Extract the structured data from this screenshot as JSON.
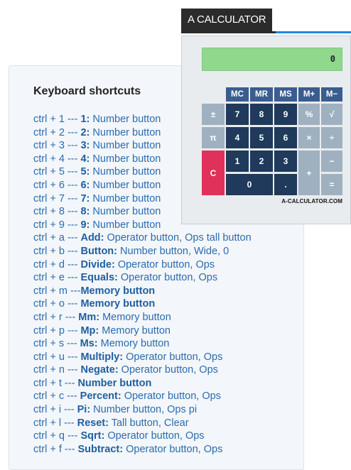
{
  "panel": {
    "title": "Keyboard shortcuts",
    "shortcuts": [
      {
        "combo": "ctrl + 1 --- ",
        "name": "1:",
        "desc": " Number button"
      },
      {
        "combo": "ctrl + 2 --- ",
        "name": "2:",
        "desc": " Number button"
      },
      {
        "combo": "ctrl + 3 --- ",
        "name": "3:",
        "desc": " Number button"
      },
      {
        "combo": "ctrl + 4 --- ",
        "name": "4:",
        "desc": " Number button"
      },
      {
        "combo": "ctrl + 5 --- ",
        "name": "5:",
        "desc": " Number button"
      },
      {
        "combo": "ctrl + 6 --- ",
        "name": "6:",
        "desc": " Number button"
      },
      {
        "combo": "ctrl + 7 --- ",
        "name": "7:",
        "desc": " Number button"
      },
      {
        "combo": "ctrl + 8 --- ",
        "name": "8:",
        "desc": " Number button"
      },
      {
        "combo": "ctrl + 9 --- ",
        "name": "9:",
        "desc": " Number button"
      },
      {
        "combo": "ctrl + a --- ",
        "name": "Add:",
        "desc": " Operator button, Ops tall button"
      },
      {
        "combo": "ctrl + b --- ",
        "name": "Button:",
        "desc": " Number button, Wide, 0"
      },
      {
        "combo": "ctrl + d --- ",
        "name": "Divide:",
        "desc": " Operator button, Ops"
      },
      {
        "combo": "ctrl + e --- ",
        "name": "Equals:",
        "desc": " Operator button, Ops"
      },
      {
        "combo": "ctrl + m ---",
        "name": "Memory button",
        "desc": ""
      },
      {
        "combo": "ctrl + o --- ",
        "name": "Memory button",
        "desc": ""
      },
      {
        "combo": "ctrl + r ---  ",
        "name": "Mm:",
        "desc": " Memory button"
      },
      {
        "combo": "ctrl + p ---  ",
        "name": "Mp:",
        "desc": " Memory button"
      },
      {
        "combo": "ctrl + s ---  ",
        "name": "Ms:",
        "desc": " Memory button"
      },
      {
        "combo": "ctrl + u --- ",
        "name": "Multiply:",
        "desc": " Operator button, Ops"
      },
      {
        "combo": "ctrl + n --- ",
        "name": "Negate:",
        "desc": " Operator button, Ops"
      },
      {
        "combo": "ctrl + t ---  ",
        "name": "Number button",
        "desc": ""
      },
      {
        "combo": "ctrl + c --- ",
        "name": "Percent:",
        "desc": " Operator button, Ops"
      },
      {
        "combo": "ctrl + i ---  ",
        "name": "Pi:",
        "desc": " Number button, Ops pi"
      },
      {
        "combo": "ctrl + l ---  ",
        "name": "Reset:",
        "desc": " Tall button, Clear"
      },
      {
        "combo": "ctrl + q --- ",
        "name": "Sqrt:",
        "desc": " Operator button, Ops"
      },
      {
        "combo": "ctrl + f ---  ",
        "name": "Subtract:",
        "desc": " Operator button, Ops"
      }
    ]
  },
  "calculator": {
    "tab_title": "A CALCULATOR",
    "display_value": "0",
    "brand": "A-CALCULATOR.COM",
    "keys": {
      "mc": "MC",
      "mr": "MR",
      "ms": "MS",
      "mplus": "M+",
      "mminus": "M−",
      "negate": "±",
      "pi": "π",
      "clear": "C",
      "seven": "7",
      "eight": "8",
      "nine": "9",
      "four": "4",
      "five": "5",
      "six": "6",
      "one": "1",
      "two": "2",
      "three": "3",
      "zero": "0",
      "decimal": ".",
      "percent": "%",
      "sqrt": "√",
      "multiply": "×",
      "divide": "÷",
      "subtract": "−",
      "add": "+",
      "equals": "="
    }
  },
  "colors": {
    "display": "#8fd88c",
    "memory_key": "#3a5d8f",
    "number_key": "#1f3a5a",
    "operator_key": "#9fb1c0",
    "clear_key": "#e0315b",
    "tab_accent": "#1e88e5",
    "link_text": "#2b6cb0"
  }
}
